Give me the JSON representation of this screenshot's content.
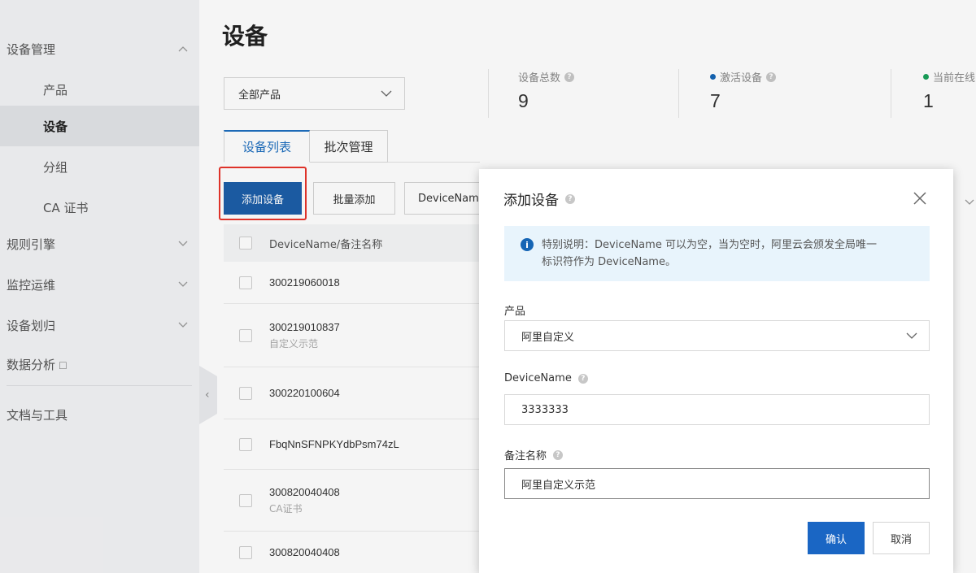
{
  "sidebar": {
    "items": [
      {
        "label": "设备管理"
      },
      {
        "label": "产品"
      },
      {
        "label": "设备"
      },
      {
        "label": "分组"
      },
      {
        "label": "CA 证书"
      },
      {
        "label": "规则引擎"
      },
      {
        "label": "监控运维"
      },
      {
        "label": "设备划归"
      },
      {
        "label": "数据分析"
      },
      {
        "label": "文档与工具"
      }
    ]
  },
  "header": {
    "title": "设备"
  },
  "filter": {
    "product_select": "全部产品"
  },
  "stats": [
    {
      "label": "设备总数",
      "value": "9"
    },
    {
      "label": "激活设备",
      "value": "7",
      "dot_color": "#1565b5"
    },
    {
      "label": "当前在线",
      "value": "1",
      "dot_color": "#1aa15a"
    }
  ],
  "tabs": [
    {
      "label": "设备列表"
    },
    {
      "label": "批次管理"
    }
  ],
  "toolbar": {
    "add_label": "添加设备",
    "batch_label": "批量添加",
    "devicename_label": "DeviceName"
  },
  "table": {
    "header": "DeviceName/备注名称",
    "rows": [
      {
        "name": "300219060018",
        "note": ""
      },
      {
        "name": "300219010837",
        "note": "自定义示范"
      },
      {
        "name": "300220100604",
        "note": ""
      },
      {
        "name": "FbqNnSFNPKYdbPsm74zL",
        "note": ""
      },
      {
        "name": "300820040408",
        "note": "CA证书"
      },
      {
        "name": "300820040408",
        "note": ""
      }
    ]
  },
  "dialog": {
    "title": "添加设备",
    "notice_line1": "特别说明：DeviceName 可以为空，当为空时，阿里云会颁发全局唯一",
    "notice_line2": "标识符作为 DeviceName。",
    "product_label": "产品",
    "product_value": "阿里自定义",
    "devicename_label": "DeviceName",
    "devicename_value": "3333333",
    "note_label": "备注名称",
    "note_value": "阿里自定义示范",
    "confirm_label": "确认",
    "cancel_label": "取消"
  }
}
